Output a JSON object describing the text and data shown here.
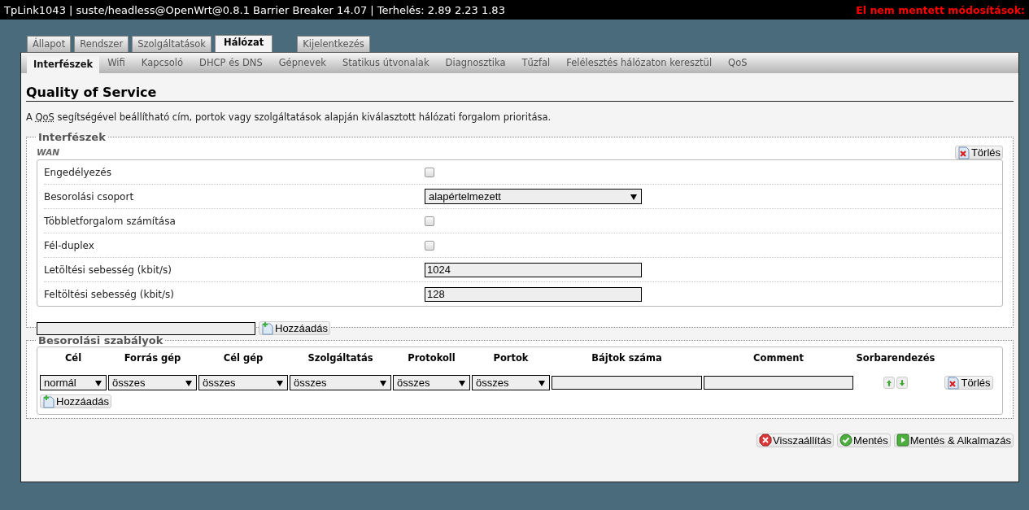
{
  "header": {
    "title": "TpLink1043 | suste/headless@OpenWrt@0.8.1 Barrier Breaker 14.07 | Terhelés: 2.89 2.23 1.83",
    "warning": "El nem mentett módosítások:"
  },
  "main_tabs": [
    {
      "label": "Állapot",
      "selected": false
    },
    {
      "label": "Rendszer",
      "selected": false
    },
    {
      "label": "Szolgáltatások",
      "selected": false
    },
    {
      "label": "Hálózat",
      "selected": true
    },
    {
      "label": "Kijelentkezés",
      "selected": false,
      "kind": "logout"
    }
  ],
  "sub_tabs": [
    {
      "label": "Interfészek",
      "selected": true
    },
    {
      "label": "Wifi",
      "selected": false
    },
    {
      "label": "Kapcsoló",
      "selected": false
    },
    {
      "label": "DHCP és DNS",
      "selected": false
    },
    {
      "label": "Gépnevek",
      "selected": false
    },
    {
      "label": "Statikus útvonalak",
      "selected": false
    },
    {
      "label": "Diagnosztika",
      "selected": false
    },
    {
      "label": "Tűzfal",
      "selected": false
    },
    {
      "label": "Felélesztés hálózaton keresztül",
      "selected": false
    },
    {
      "label": "QoS",
      "selected": false
    }
  ],
  "page": {
    "title": "Quality of Service",
    "description": {
      "before": "A",
      "abbr": "QoS",
      "after": "segítségével beállítható cím, portok vagy szolgáltatások alapján kiválasztott hálózati forgalom prioritása."
    }
  },
  "interfaces": {
    "legend": "Interfészek",
    "section_title": "WAN",
    "delete_button": "Törlés",
    "fields": [
      {
        "label": "Engedélyezés",
        "kind": "checkbox",
        "checked": false
      },
      {
        "label": "Besorolási csoport",
        "kind": "select",
        "value": "alapértelmezett"
      },
      {
        "label": "Többletforgalom számítása",
        "kind": "checkbox",
        "checked": false
      },
      {
        "label": "Fél-duplex",
        "kind": "checkbox",
        "checked": false
      },
      {
        "label": "Letöltési sebesség (kbit/s)",
        "kind": "text",
        "value": "1024"
      },
      {
        "label": "Feltöltési sebesség (kbit/s)",
        "kind": "text",
        "value": "128"
      }
    ],
    "add_button": "Hozzáadás"
  },
  "rules": {
    "legend": "Besorolási szabályok",
    "columns": [
      "Cél",
      "Forrás gép",
      "Cél gép",
      "Szolgáltatás",
      "Protokoll",
      "Portok",
      "Bájtok száma",
      "Comment",
      "Sorbarendezés"
    ],
    "rows": [
      {
        "cells": [
          {
            "kind": "select",
            "value": "normál"
          },
          {
            "kind": "select",
            "value": "összes"
          },
          {
            "kind": "select",
            "value": "összes"
          },
          {
            "kind": "select",
            "value": "összes"
          },
          {
            "kind": "select",
            "value": "összes"
          },
          {
            "kind": "select",
            "value": "összes"
          },
          {
            "kind": "text"
          },
          {
            "kind": "text"
          },
          {
            "kind": "sort"
          }
        ],
        "delete_button": "Törlés"
      }
    ],
    "add_button": "Hozzáadás"
  },
  "footer_buttons": [
    {
      "label": "Visszaállítás",
      "kind": "reset"
    },
    {
      "label": "Mentés",
      "kind": "save"
    },
    {
      "label": "Mentés & Alkalmazás",
      "kind": "apply"
    }
  ]
}
